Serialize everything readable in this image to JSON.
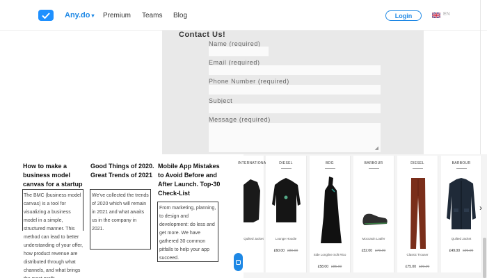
{
  "nav": {
    "brand": "Any.do",
    "links": [
      "Premium",
      "Teams",
      "Blog"
    ],
    "login": "Login",
    "lang": "EN"
  },
  "contact": {
    "title": "Contact Us!",
    "fields": [
      "Name (required)",
      "Email (required)",
      "Phone Number (required)",
      "Subject",
      "Message (required)"
    ]
  },
  "blog": {
    "posts": [
      {
        "title": "How to make a business model canvas for a startup",
        "excerpt": "The BMC (business model canvas) is a tool for visualizing a business model in a simple, structured manner. This method can lead to better understanding of your offer, how product revenue are distributed through what channels, and what brings the most profit."
      },
      {
        "title": "Good Things of 2020. Great Trends of 2021",
        "excerpt": "We've collected the trends of 2020 which will remain in 2021 and what awaits us in the company in 2021."
      },
      {
        "title": "Mobile App Mistakes to Avoid Before and After Launch. Top-30 Check-List",
        "excerpt": "From marketing, planning, to design and development: do less and get more. We have gathered 30 common pitfalls to help your app succeed."
      }
    ]
  },
  "products": [
    {
      "brand": "INTERNATIONAL",
      "name": "Quilted Jacket",
      "price": "",
      "old": ""
    },
    {
      "brand": "DIESEL",
      "name": "Lounge Hoodie",
      "price": "£60.00",
      "old": "£80.00"
    },
    {
      "brand": "BDG",
      "name": "Side Longline Soft Rico",
      "price": "£58.00",
      "old": "£85.00"
    },
    {
      "brand": "BARBOUR",
      "name": "Moccasin Loafer",
      "price": "£52.00",
      "old": "£70.00"
    },
    {
      "brand": "DIESEL",
      "name": "Classic Trouser",
      "price": "£75.00",
      "old": "£90.00"
    },
    {
      "brand": "BARBOUR",
      "name": "Quilted Jacket",
      "price": "£49.00",
      "old": "£99.00"
    }
  ]
}
